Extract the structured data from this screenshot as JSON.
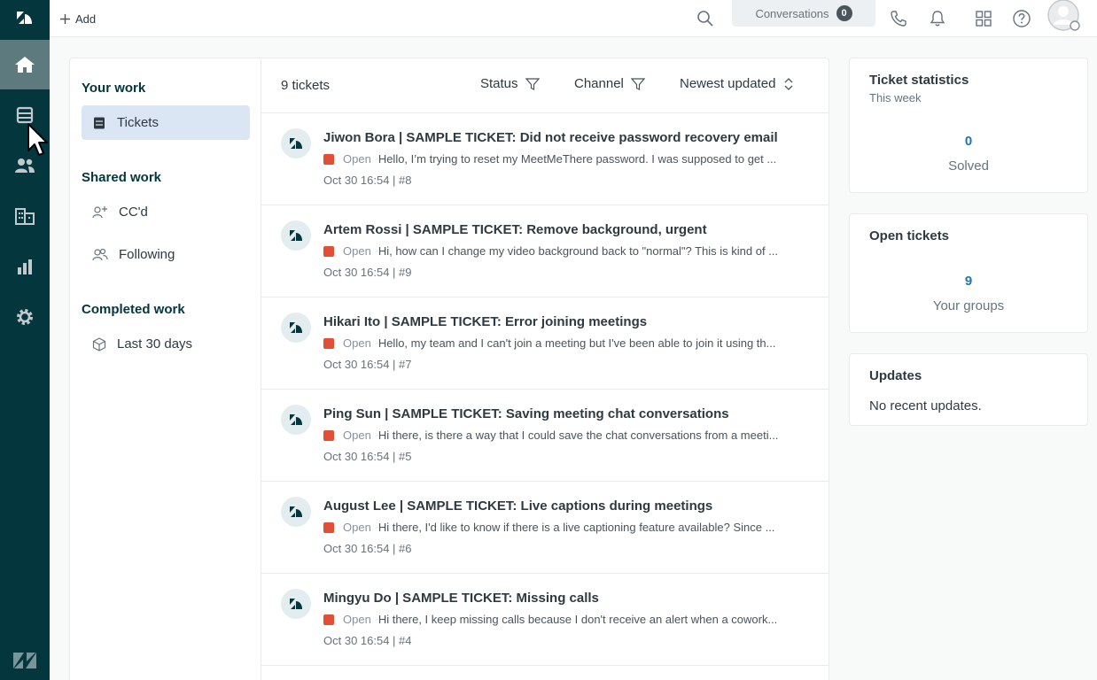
{
  "rail": {
    "items": [
      {
        "icon": "home-icon",
        "active": true
      },
      {
        "icon": "tickets-icon",
        "active": false
      },
      {
        "icon": "users-icon",
        "active": false
      },
      {
        "icon": "organizations-icon",
        "active": false
      },
      {
        "icon": "reporting-icon",
        "active": false
      },
      {
        "icon": "settings-icon",
        "active": false
      }
    ]
  },
  "topbar": {
    "add_label": "Add",
    "conversations_label": "Conversations",
    "conversations_count": "0"
  },
  "nav": {
    "your_work": "Your work",
    "tickets": "Tickets",
    "shared_work": "Shared work",
    "ccd": "CC'd",
    "following": "Following",
    "completed_work": "Completed work",
    "last_30_days": "Last 30 days"
  },
  "list": {
    "count_label": "9 tickets",
    "filter_status": "Status",
    "filter_channel": "Channel",
    "sort_label": "Newest updated",
    "tickets": [
      {
        "title": "Jiwon Bora | SAMPLE TICKET: Did not receive password recovery email",
        "status": "Open",
        "preview": "Hello, I’m trying to reset my MeetMeThere password. I was supposed to get ...",
        "meta": "Oct 30 16:54 | #8"
      },
      {
        "title": "Artem Rossi | SAMPLE TICKET: Remove background, urgent",
        "status": "Open",
        "preview": "Hi, how can I change my video background back to \"normal\"? This is kind of ...",
        "meta": "Oct 30 16:54 | #9"
      },
      {
        "title": "Hikari Ito | SAMPLE TICKET: Error joining meetings",
        "status": "Open",
        "preview": "Hello, my team and I can't join a meeting but I've been able to join it using th...",
        "meta": "Oct 30 16:54 | #7"
      },
      {
        "title": "Ping Sun | SAMPLE TICKET: Saving meeting chat conversations",
        "status": "Open",
        "preview": "Hi there, is there a way that I could save the chat conversations from a meeti...",
        "meta": "Oct 30 16:54 | #5"
      },
      {
        "title": "August Lee | SAMPLE TICKET: Live captions during meetings",
        "status": "Open",
        "preview": "Hi there, I'd like to know if there is a live captioning feature available? Since ...",
        "meta": "Oct 30 16:54 | #6"
      },
      {
        "title": "Mingyu Do | SAMPLE TICKET: Missing calls",
        "status": "Open",
        "preview": "Hi there, I keep missing calls because I don't receive an alert when a cowork...",
        "meta": "Oct 30 16:54 | #4"
      }
    ]
  },
  "side": {
    "stats_title": "Ticket statistics",
    "stats_period": "This week",
    "solved_count": "0",
    "solved_label": "Solved",
    "open_title": "Open tickets",
    "open_count": "9",
    "open_label": "Your groups",
    "updates_title": "Updates",
    "updates_text": "No recent updates."
  },
  "colors": {
    "rail": "#03363d",
    "rail_active": "#5d7b7f",
    "open_status": "#e34f32",
    "link": "#1f73b7",
    "selected_nav": "#dbe6f4"
  }
}
